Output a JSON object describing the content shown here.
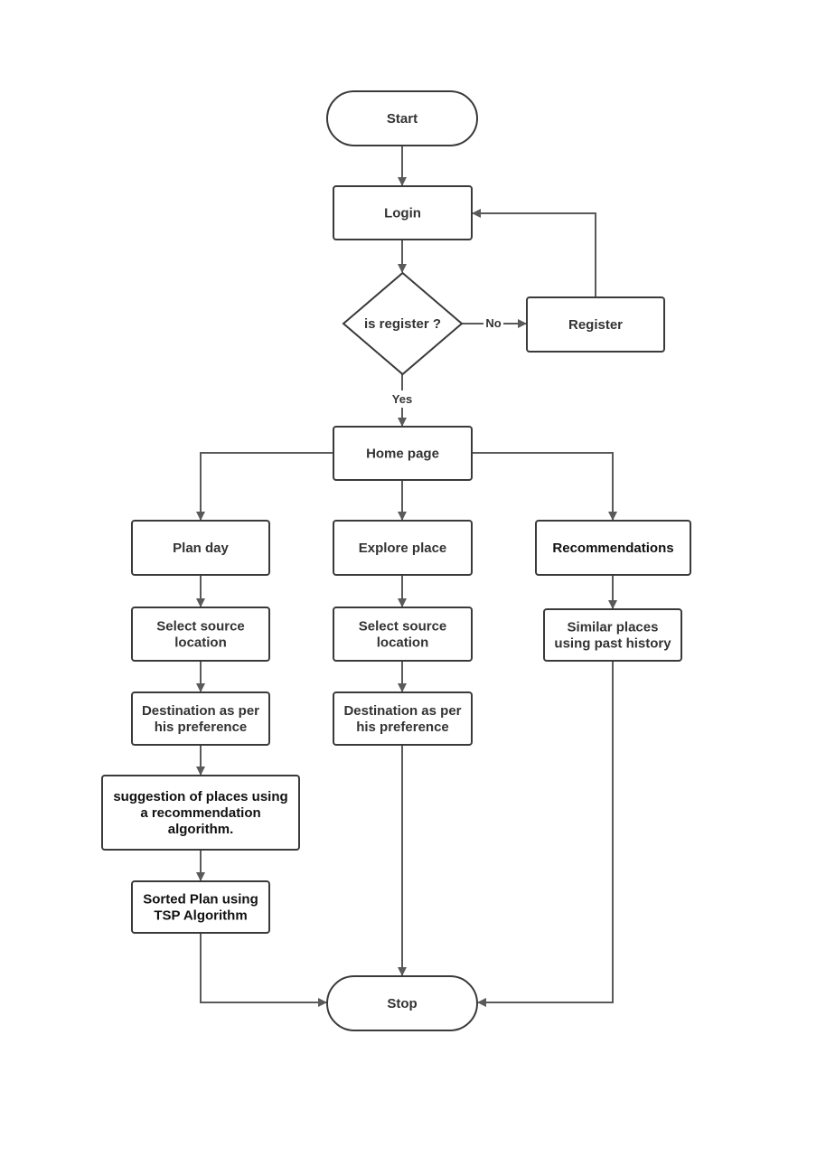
{
  "diagram": {
    "type": "flowchart",
    "colors": {
      "stroke": "#3a3a3a",
      "edge": "#5a5a5a",
      "text": "#333333",
      "background": "#ffffff"
    },
    "nodes": {
      "start": {
        "kind": "terminal",
        "lines": [
          "Start"
        ]
      },
      "login": {
        "kind": "process",
        "lines": [
          "Login"
        ]
      },
      "is_register": {
        "kind": "decision",
        "lines": [
          "is register ?"
        ]
      },
      "register": {
        "kind": "process",
        "lines": [
          "Register"
        ]
      },
      "home": {
        "kind": "process",
        "lines": [
          "Home page"
        ]
      },
      "plan_day": {
        "kind": "process",
        "lines": [
          "Plan day"
        ]
      },
      "explore_place": {
        "kind": "process",
        "lines": [
          "Explore place"
        ]
      },
      "recommendations": {
        "kind": "process",
        "lines": [
          "Recommendations"
        ]
      },
      "plan_select_source": {
        "kind": "process",
        "lines": [
          "Select source",
          "location"
        ]
      },
      "plan_destination": {
        "kind": "process",
        "lines": [
          "Destination as per",
          "his preference"
        ]
      },
      "suggestion": {
        "kind": "process",
        "lines": [
          "suggestion of places using",
          "a recommendation",
          "algorithm."
        ]
      },
      "sorted_plan": {
        "kind": "process",
        "lines": [
          "Sorted Plan using",
          "TSP Algorithm"
        ]
      },
      "explore_select_source": {
        "kind": "process",
        "lines": [
          "Select source",
          "location"
        ]
      },
      "explore_destination": {
        "kind": "process",
        "lines": [
          "Destination as per",
          "his preference"
        ]
      },
      "similar_places": {
        "kind": "process",
        "lines": [
          "Similar places",
          "using past history"
        ]
      },
      "stop": {
        "kind": "terminal",
        "lines": [
          "Stop"
        ]
      }
    },
    "edges": [
      {
        "from": "start",
        "to": "login"
      },
      {
        "from": "login",
        "to": "is_register"
      },
      {
        "from": "is_register",
        "to": "register",
        "label": "No"
      },
      {
        "from": "register",
        "to": "login"
      },
      {
        "from": "is_register",
        "to": "home",
        "label": "Yes"
      },
      {
        "from": "home",
        "to": "plan_day"
      },
      {
        "from": "home",
        "to": "explore_place"
      },
      {
        "from": "home",
        "to": "recommendations"
      },
      {
        "from": "plan_day",
        "to": "plan_select_source"
      },
      {
        "from": "plan_select_source",
        "to": "plan_destination"
      },
      {
        "from": "plan_destination",
        "to": "suggestion"
      },
      {
        "from": "suggestion",
        "to": "sorted_plan"
      },
      {
        "from": "sorted_plan",
        "to": "stop"
      },
      {
        "from": "explore_place",
        "to": "explore_select_source"
      },
      {
        "from": "explore_select_source",
        "to": "explore_destination"
      },
      {
        "from": "explore_destination",
        "to": "stop"
      },
      {
        "from": "recommendations",
        "to": "similar_places"
      },
      {
        "from": "similar_places",
        "to": "stop"
      }
    ]
  }
}
